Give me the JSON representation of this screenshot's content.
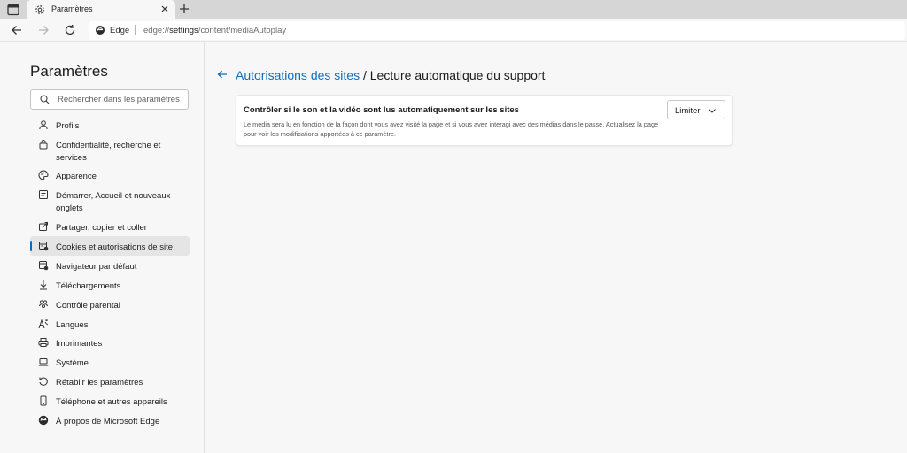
{
  "browser": {
    "tab": {
      "title": "Paramètres",
      "favicon": "gear-icon"
    },
    "address": {
      "site_name": "Edge",
      "url_scheme": "edge://",
      "url_host": "settings",
      "url_path": "/content/mediaAutoplay"
    }
  },
  "sidebar": {
    "title": "Paramètres",
    "search_placeholder": "Rechercher dans les paramètres",
    "items": [
      {
        "label": "Profils",
        "icon": "profile-icon"
      },
      {
        "label": "Confidentialité, recherche et services",
        "icon": "lock-icon"
      },
      {
        "label": "Apparence",
        "icon": "palette-icon"
      },
      {
        "label": "Démarrer, Accueil et nouveaux onglets",
        "icon": "start-page-icon"
      },
      {
        "label": "Partager, copier et coller",
        "icon": "share-icon"
      },
      {
        "label": "Cookies et autorisations de site",
        "icon": "cookies-icon",
        "active": true
      },
      {
        "label": "Navigateur par défaut",
        "icon": "default-browser-icon"
      },
      {
        "label": "Téléchargements",
        "icon": "download-icon"
      },
      {
        "label": "Contrôle parental",
        "icon": "family-icon"
      },
      {
        "label": "Langues",
        "icon": "language-icon"
      },
      {
        "label": "Imprimantes",
        "icon": "printer-icon"
      },
      {
        "label": "Système",
        "icon": "laptop-icon"
      },
      {
        "label": "Rétablir les paramètres",
        "icon": "reset-icon"
      },
      {
        "label": "Téléphone et autres appareils",
        "icon": "phone-icon"
      },
      {
        "label": "À propos de Microsoft Edge",
        "icon": "edge-logo-icon"
      }
    ]
  },
  "main": {
    "breadcrumb": {
      "parent": "Autorisations des sites",
      "separator": " / ",
      "current": "Lecture automatique du support"
    },
    "card": {
      "title": "Contrôler si le son et la vidéo sont lus automatiquement sur les sites",
      "description": "Le média sera lu en fonction de la façon dont vous avez visité la page et si vous avez interagi avec des médias dans le passé. Actualisez la page pour voir les modifications apportées à ce paramètre.",
      "select_value": "Limiter"
    }
  },
  "colors": {
    "accent": "#0f6cbd",
    "background": "#f7f7f7",
    "tabstrip": "#d6d6d6"
  }
}
